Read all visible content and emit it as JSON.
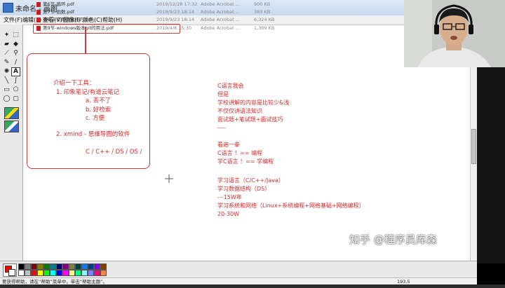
{
  "window": {
    "title": "未命名 - 画图",
    "menus": [
      "文件(F)",
      "编辑(E)",
      "查看(V)",
      "图像(I)",
      "颜色(C)",
      "帮助(H)"
    ]
  },
  "file_list": [
    {
      "name": "第6节-循环.pdf",
      "date": "2019/12/28 17:32",
      "type": "Adobe Acrobat ...",
      "size": "900 KB"
    },
    {
      "name": "第7节-函数.pdf",
      "date": "2019/9/23 18:14",
      "type": "Adobe Acrobat ...",
      "size": "383 KB"
    },
    {
      "name": "第8节-实用调试技巧.pdf",
      "date": "2019/9/23 18:14",
      "type": "Adobe Acrobat ...",
      "size": "6,324 KB"
    },
    {
      "name": "第9节-windows版本git的用法.pdf",
      "date": "2019/4/8 15:30",
      "type": "Adobe Acrobat ...",
      "size": "1,309 KB"
    }
  ],
  "left_note": {
    "heading": "介绍一下工具：",
    "item1": "1. 印象笔记/有道云笔记",
    "sub_a": "a. 丢不了",
    "sub_b": "b. 好检索",
    "sub_c": "c. 方便",
    "item2": "2. xmind - 思维导图的软件",
    "topics": "C / C++ / DS / OS /"
  },
  "right_notes": [
    "C语言我会",
    "但是",
    "学校讲解的内容是比较少&浅",
    "不仅仅讲语法知识",
    "面试题+笔试题+面试技巧",
    "----",
    "",
    "看遍一拳",
    "C语言 ！== 编程",
    "学C语言 ！== 学编程",
    "",
    "学习语言（C/C++/Java）",
    "学习数据结构（DS）",
    "---15W年",
    "学习系统和网络（Linux+系统编程+网络基础+网络编程）",
    "20-30W"
  ],
  "watermark": "知乎 @程序员库森",
  "status": {
    "help_text": "要获得帮助，请在“帮助”菜单中，单击“帮助主题”。",
    "coords": "193,5"
  },
  "palette_colors": [
    "#000000",
    "#808080",
    "#800000",
    "#808000",
    "#008000",
    "#008080",
    "#000080",
    "#800080",
    "#808040",
    "#004040",
    "#0080ff",
    "#004080",
    "#8000ff",
    "#804000",
    "#ffffff",
    "#c0c0c0",
    "#ff0000",
    "#ffff00",
    "#00ff00",
    "#00ffff",
    "#0000ff",
    "#ff00ff",
    "#ffff80",
    "#00ff80",
    "#80ffff",
    "#8080ff",
    "#ff0080",
    "#ff8040"
  ],
  "primary_color": "#ff0000",
  "secondary_color": "#ffffff"
}
